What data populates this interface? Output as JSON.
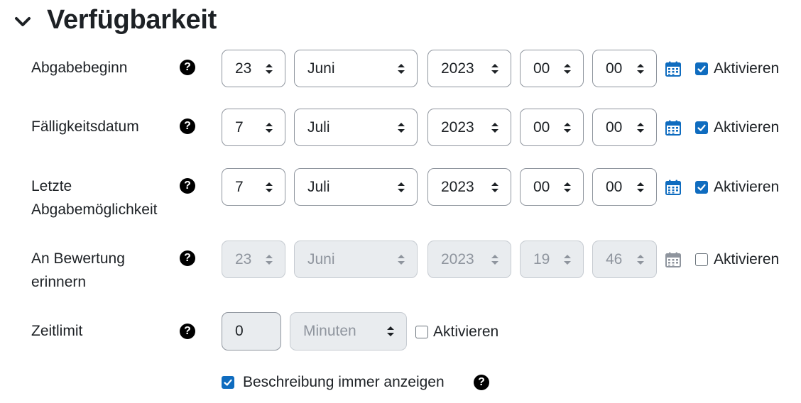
{
  "section": {
    "title": "Verfügbarkeit"
  },
  "rows": [
    {
      "label_1": "Abgabebeginn",
      "label_2": "",
      "day": "23",
      "month": "Juni",
      "year": "2023",
      "hour": "00",
      "minute": "00",
      "enabled": true,
      "checkbox_label": "Aktivieren"
    },
    {
      "label_1": "Fälligkeitsdatum",
      "label_2": "",
      "day": "7",
      "month": "Juli",
      "year": "2023",
      "hour": "00",
      "minute": "00",
      "enabled": true,
      "checkbox_label": "Aktivieren"
    },
    {
      "label_1": "Letzte",
      "label_2": "Abgabemöglichkeit",
      "day": "7",
      "month": "Juli",
      "year": "2023",
      "hour": "00",
      "minute": "00",
      "enabled": true,
      "checkbox_label": "Aktivieren"
    },
    {
      "label_1": "An Bewertung",
      "label_2": "erinnern",
      "day": "23",
      "month": "Juni",
      "year": "2023",
      "hour": "19",
      "minute": "46",
      "enabled": false,
      "checkbox_label": "Aktivieren"
    }
  ],
  "timelimit": {
    "label": "Zeitlimit",
    "value": "0",
    "unit": "Minuten",
    "enabled": false,
    "checkbox_label": "Aktivieren"
  },
  "always_show": {
    "checked": true,
    "label": "Beschreibung immer anzeigen"
  },
  "help_glyph": "?",
  "icons": {
    "collapse": "chevron-down-icon",
    "help": "question-circle-icon",
    "calendar": "calendar-icon",
    "select_arrows": "sort-arrows-icon"
  },
  "colors": {
    "accent": "#0f6cbf",
    "disabled_bg": "#e9ecef",
    "disabled_text": "#8f959e",
    "text": "#1d2125"
  }
}
